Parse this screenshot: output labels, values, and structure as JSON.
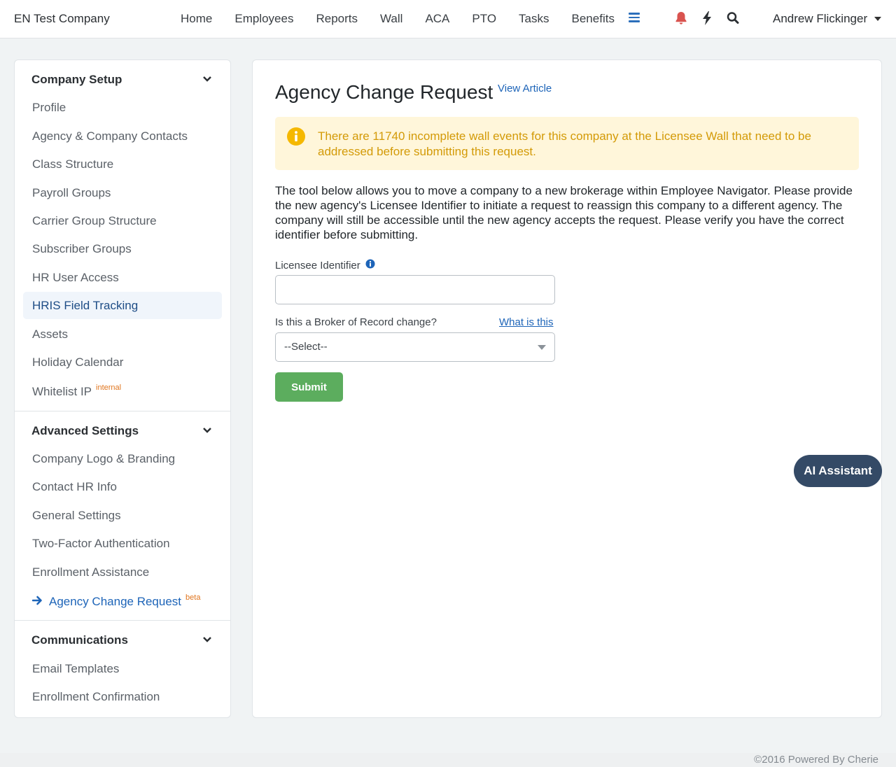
{
  "header": {
    "brand": "EN Test Company",
    "nav": [
      "Home",
      "Employees",
      "Reports",
      "Wall",
      "ACA",
      "PTO",
      "Tasks",
      "Benefits"
    ],
    "user": "Andrew Flickinger"
  },
  "sidebar": {
    "company_setup": {
      "title": "Company Setup",
      "items": [
        "Profile",
        "Agency & Company Contacts",
        "Class Structure",
        "Payroll Groups",
        "Carrier Group Structure",
        "Subscriber Groups",
        "HR User Access",
        "HRIS Field Tracking",
        "Assets",
        "Holiday Calendar",
        "Whitelist IP"
      ],
      "whitelist_tag": "internal"
    },
    "advanced": {
      "title": "Advanced Settings",
      "items": [
        "Company Logo & Branding",
        "Contact HR Info",
        "General Settings",
        "Two-Factor Authentication",
        "Enrollment Assistance",
        "Agency Change Request"
      ],
      "current_tag": "beta"
    },
    "communications": {
      "title": "Communications",
      "items": [
        "Email Templates",
        "Enrollment Confirmation"
      ]
    }
  },
  "main": {
    "title": "Agency Change Request",
    "view_article": "View Article",
    "alert": "There are 11740 incomplete wall events for this company at the Licensee Wall that need to be addressed before submitting this request.",
    "description": "The tool below allows you to move a company to a new brokerage within Employee Navigator. Please provide the new agency's Licensee Identifier to initiate a request to reassign this company to a different agency. The company will still be accessible until the new agency accepts the request. Please verify you have the correct identifier before submitting.",
    "licensee_label": "Licensee Identifier",
    "licensee_value": "",
    "bor_label": "Is this a Broker of Record change?",
    "what_is_this": "What is this",
    "select_value": "--Select--",
    "submit": "Submit"
  },
  "ai_assistant": "AI Assistant",
  "footer": "©2016 Powered By Cherie",
  "colors": {
    "accent": "#1d64b8",
    "submit": "#5cad5e",
    "alert_bg": "#fff6da",
    "alert_text": "#d39a07",
    "ai_button": "#344a66",
    "bell": "#d9534f",
    "tag": "#e0751e"
  }
}
